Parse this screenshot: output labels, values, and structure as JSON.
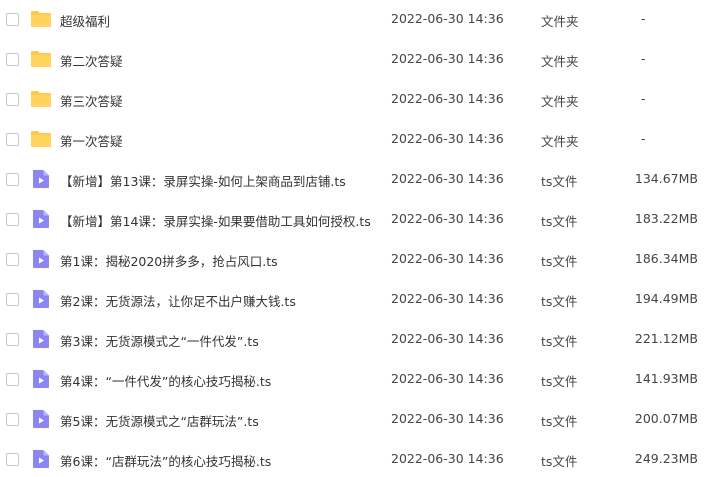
{
  "colors": {
    "folder": "#FFC94A",
    "folder_dark": "#F5B82E",
    "video": "#8C86F5",
    "video_fold": "#B9B5FA"
  },
  "rows": [
    {
      "icon": "folder-icon",
      "name": "超级福利",
      "time": "2022-06-30 14:36",
      "type": "文件夹",
      "size": "-"
    },
    {
      "icon": "folder-icon",
      "name": "第二次答疑",
      "time": "2022-06-30 14:36",
      "type": "文件夹",
      "size": "-"
    },
    {
      "icon": "folder-icon",
      "name": "第三次答疑",
      "time": "2022-06-30 14:36",
      "type": "文件夹",
      "size": "-"
    },
    {
      "icon": "folder-icon",
      "name": "第一次答疑",
      "time": "2022-06-30 14:36",
      "type": "文件夹",
      "size": "-"
    },
    {
      "icon": "video-file-icon",
      "name": "【新增】第13课：录屏实操-如何上架商品到店铺.ts",
      "time": "2022-06-30 14:36",
      "type": "ts文件",
      "size": "134.67MB"
    },
    {
      "icon": "video-file-icon",
      "name": "【新增】第14课：录屏实操-如果要借助工具如何授权.ts",
      "time": "2022-06-30 14:36",
      "type": "ts文件",
      "size": "183.22MB"
    },
    {
      "icon": "video-file-icon",
      "name": "第1课：揭秘2020拼多多，抢占风口.ts",
      "time": "2022-06-30 14:36",
      "type": "ts文件",
      "size": "186.34MB"
    },
    {
      "icon": "video-file-icon",
      "name": "第2课：无货源法，让你足不出户赚大钱.ts",
      "time": "2022-06-30 14:36",
      "type": "ts文件",
      "size": "194.49MB"
    },
    {
      "icon": "video-file-icon",
      "name": "第3课：无货源模式之“一件代发”.ts",
      "time": "2022-06-30 14:36",
      "type": "ts文件",
      "size": "221.12MB"
    },
    {
      "icon": "video-file-icon",
      "name": "第4课：“一件代发”的核心技巧揭秘.ts",
      "time": "2022-06-30 14:36",
      "type": "ts文件",
      "size": "141.93MB"
    },
    {
      "icon": "video-file-icon",
      "name": "第5课：无货源模式之“店群玩法”.ts",
      "time": "2022-06-30 14:36",
      "type": "ts文件",
      "size": "200.07MB"
    },
    {
      "icon": "video-file-icon",
      "name": "第6课：“店群玩法”的核心技巧揭秘.ts",
      "time": "2022-06-30 14:36",
      "type": "ts文件",
      "size": "249.23MB"
    }
  ]
}
